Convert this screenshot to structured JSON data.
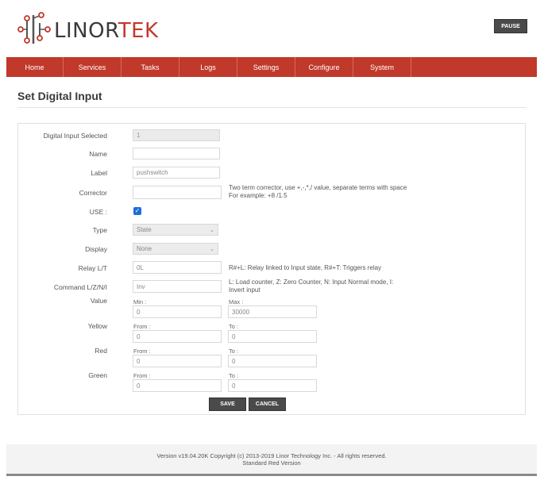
{
  "header": {
    "logo_part1": "LINOR",
    "logo_part2": "TEK",
    "pause_label": "PAUSE"
  },
  "nav": {
    "items": [
      "Home",
      "Services",
      "Tasks",
      "Logs",
      "Settings",
      "Configure",
      "System"
    ]
  },
  "page": {
    "title": "Set Digital Input"
  },
  "form": {
    "digital_input_selected": {
      "label": "Digital Input Selected",
      "value": "1"
    },
    "name": {
      "label": "Name",
      "value": ""
    },
    "label": {
      "label": "Label",
      "value": "pushswitch"
    },
    "corrector": {
      "label": "Corrector",
      "value": "",
      "help_line1": "Two term corrector, use +,-,*,/ value, separate terms with space",
      "help_line2": "For example: +8 /1.5"
    },
    "use": {
      "label": "USE :",
      "checked": true
    },
    "type": {
      "label": "Type",
      "value": "State"
    },
    "display": {
      "label": "Display",
      "value": "None"
    },
    "relay": {
      "label": "Relay L/T",
      "value": "0L",
      "help": "R#+L: Relay linked to Input state, R#+T: Triggers relay"
    },
    "command": {
      "label": "Command L/Z/N/I",
      "value": "Inv",
      "help_line1": "L: Load counter, Z: Zero Counter, N: Input Normal mode, I:",
      "help_line2": "Invert input"
    },
    "value": {
      "label": "Value",
      "min_label": "Min :",
      "min": "0",
      "max_label": "Max :",
      "max": "30000"
    },
    "yellow": {
      "label": "Yellow",
      "from_label": "From :",
      "from": "0",
      "to_label": "To :",
      "to": "0"
    },
    "red": {
      "label": "Red",
      "from_label": "From :",
      "from": "0",
      "to_label": "To :",
      "to": "0"
    },
    "green": {
      "label": "Green",
      "from_label": "From :",
      "from": "0",
      "to_label": "To :",
      "to": "0"
    },
    "save_label": "SAVE",
    "cancel_label": "CANCEL"
  },
  "footer": {
    "line1": "Version v19.04.20K Copyright (c) 2013-2019 Linor Technology Inc. - All rights reserved.",
    "line2": "Standard Red Version"
  },
  "colors": {
    "brand_red": "#c0392b",
    "button_dark": "#4a4a4a",
    "checkbox_blue": "#1d6fd8"
  }
}
